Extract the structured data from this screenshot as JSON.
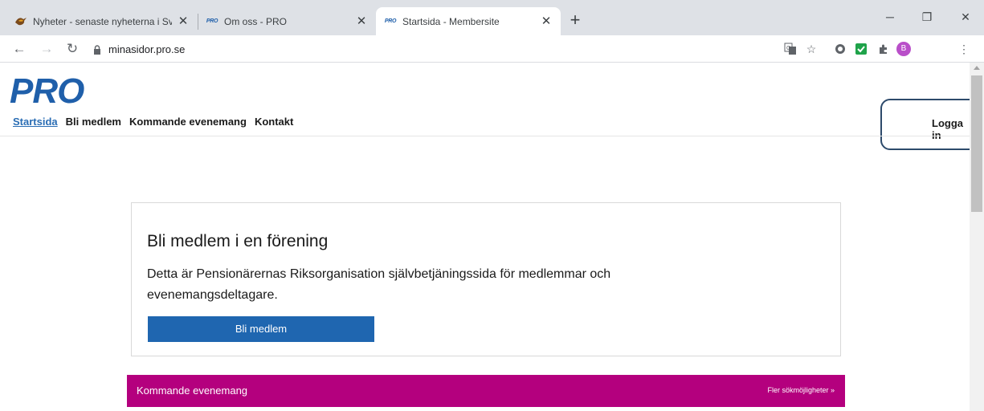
{
  "browser": {
    "tabs": [
      {
        "title": "Nyheter - senaste nyheterna i Sve",
        "icon": "bird-favicon-icon",
        "active": false
      },
      {
        "title": "Om oss - PRO",
        "icon": "pro-favicon-icon",
        "active": false
      },
      {
        "title": "Startsida - Membersite",
        "icon": "pro-favicon-icon",
        "active": true
      }
    ],
    "favicon_text": "PRO",
    "url": "minasidor.pro.se",
    "profile_initial": "B"
  },
  "site": {
    "logo_text": "PRO",
    "nav": [
      "Startsida",
      "Bli medlem",
      "Kommande evenemang",
      "Kontakt"
    ],
    "login": "Logga in"
  },
  "card": {
    "title": "Bli medlem i en förening",
    "text": "Detta är Pensionärernas Riksorganisation självbetjäningssida för medlemmar och evenemangsdeltagare.",
    "button": "Bli medlem"
  },
  "events": {
    "title": "Kommande evenemang",
    "more": "Fler sökmöjligheter  »"
  },
  "colors": {
    "brand_blue": "#1f5faa",
    "button_blue": "#1f66b0",
    "events_magenta": "#b4007e",
    "link_blue": "#2a6db4"
  }
}
